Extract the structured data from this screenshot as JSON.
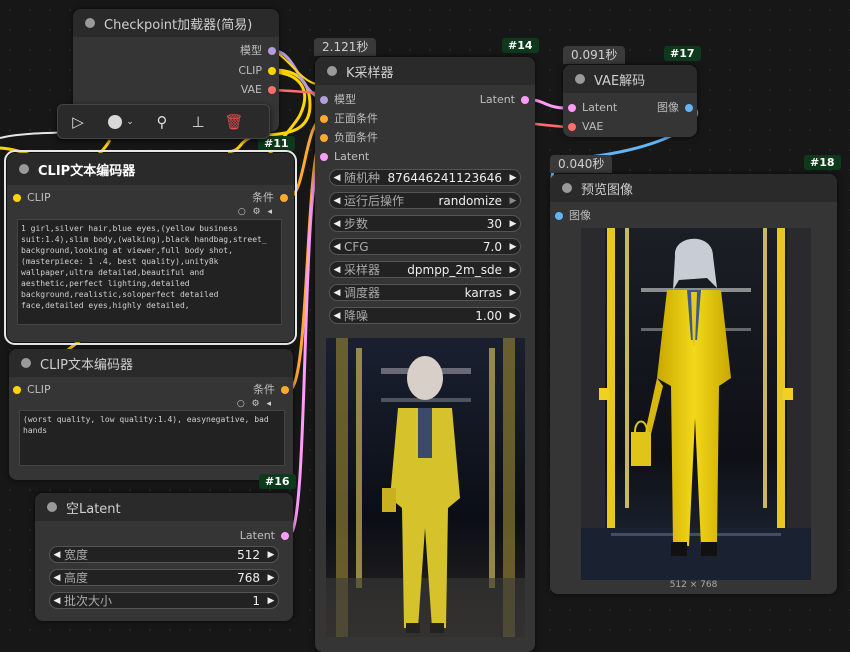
{
  "checkpoint_node": {
    "title": "Checkpoint加载器(简易)",
    "outputs": [
      "模型",
      "CLIP",
      "VAE"
    ]
  },
  "clip_node_11": {
    "id": "#11",
    "title": "CLIP文本编码器",
    "input": "CLIP",
    "output": "条件",
    "text": "1 girl,silver hair,blue eyes,(yellow business suit:1.4),slim body,(walking),black handbag,street_ background,looking at viewer,full body shot,(masterpiece: 1 .4, best quality),unity8k wallpaper,ultra detailed,beautiful and aesthetic,perfect lighting,detailed background,realistic,soloperfect detailed face,detailed eyes,highly detailed,"
  },
  "clip_node_neg": {
    "title": "CLIP文本编码器",
    "input": "CLIP",
    "output": "条件",
    "text": "(worst quality, low quality:1.4), easynegative, bad hands"
  },
  "latent_node": {
    "id": "#16",
    "title": "空Latent",
    "output": "Latent",
    "widgets": [
      {
        "label": "宽度",
        "value": "512"
      },
      {
        "label": "高度",
        "value": "768"
      },
      {
        "label": "批次大小",
        "value": "1"
      }
    ]
  },
  "ksampler_node": {
    "id": "#14",
    "timing": "2.121秒",
    "title": "K采样器",
    "inputs": [
      "模型",
      "正面条件",
      "负面条件",
      "Latent"
    ],
    "output": "Latent",
    "widgets": [
      {
        "label": "随机种",
        "value": "876446241123646"
      },
      {
        "label": "运行后操作",
        "value": "randomize"
      },
      {
        "label": "步数",
        "value": "30"
      },
      {
        "label": "CFG",
        "value": "7.0"
      },
      {
        "label": "采样器",
        "value": "dpmpp_2m_sde"
      },
      {
        "label": "调度器",
        "value": "karras"
      },
      {
        "label": "降噪",
        "value": "1.00"
      }
    ]
  },
  "vae_node": {
    "id": "#17",
    "timing": "0.091秒",
    "title": "VAE解码",
    "inputs": [
      "Latent",
      "VAE"
    ],
    "output": "图像"
  },
  "preview_node": {
    "id": "#18",
    "timing": "0.040秒",
    "title": "预览图像",
    "input": "图像",
    "image_size": "512 × 768"
  },
  "toolbar": {
    "icons": [
      "play-icon",
      "color-circle-icon",
      "bypass-wand-icon",
      "pin-icon",
      "trash-icon"
    ]
  },
  "colors": {
    "model_wire": "#b39ddb",
    "clip_wire": "#ffd500",
    "vae_wire": "#ff6e6e",
    "latent_wire": "#ff9cf9",
    "conditioning_wire": "#ffa931",
    "image_wire": "#64b5f6",
    "node_id_badge": "#0d3a1c",
    "trash": "#e05050"
  }
}
